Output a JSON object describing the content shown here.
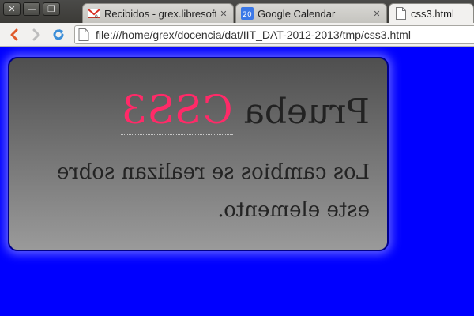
{
  "window": {
    "buttons": [
      {
        "name": "close",
        "glyph": "✕"
      },
      {
        "name": "minimize",
        "glyph": "—"
      },
      {
        "name": "restore",
        "glyph": "❐"
      }
    ]
  },
  "tabs": [
    {
      "title": "Recibidos - grex.libresoft",
      "icon": "gmail-icon",
      "active": false
    },
    {
      "title": "Google Calendar",
      "icon": "calendar-icon",
      "icon_text": "20",
      "active": false
    },
    {
      "title": "css3.html",
      "icon": "page-icon",
      "active": true
    }
  ],
  "toolbar": {
    "url": "file:///home/grex/docencia/dat/IIT_DAT-2012-2013/tmp/css3.html"
  },
  "page": {
    "heading_word": "Prueba",
    "heading_highlight": "CSS3",
    "paragraph": "Los cambios se realizan sobre este elemento."
  },
  "colors": {
    "page_background": "#0000ff",
    "highlight": "#ff2a68",
    "box_border": "#00008b",
    "box_glow": "#6060ff"
  }
}
